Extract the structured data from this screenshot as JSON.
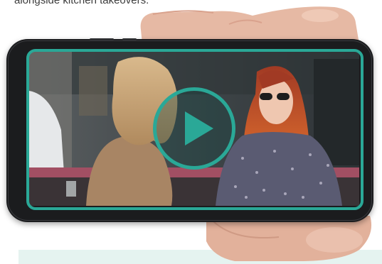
{
  "article": {
    "intro_text_fragment": "alongside kitchen takeovers."
  },
  "video": {
    "play_icon": "play-icon",
    "accent_color": "#2aa897"
  },
  "colors": {
    "caption_panel": "#e5f3f0",
    "phone_body": "#1b1c1e"
  }
}
